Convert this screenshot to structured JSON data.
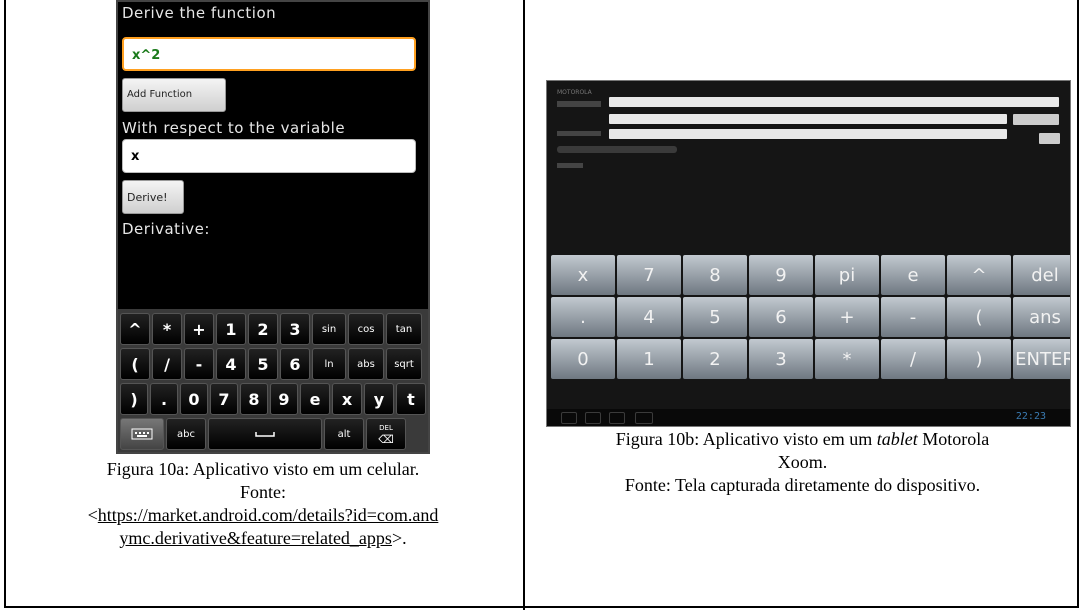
{
  "phone_screen": {
    "derive_label": "Derive the function",
    "function_value": "x^2",
    "add_function_label": "Add Function",
    "variable_label": "With respect to the variable",
    "variable_value": "x",
    "derive_button_label": "Derive!",
    "derivative_label": "Derivative:",
    "keyboard_rows": [
      [
        "^",
        "*",
        "+",
        "1",
        "2",
        "3",
        "sin",
        "cos",
        "tan"
      ],
      [
        "(",
        "/",
        "-",
        "4",
        "5",
        "6",
        "ln",
        "abs",
        "sqrt"
      ],
      [
        ")",
        ".",
        "0",
        "7",
        "8",
        "9",
        "e",
        "x",
        "y",
        "t"
      ]
    ],
    "bottom_row": {
      "abc": "abc",
      "alt": "alt",
      "del_top": "DEL",
      "del_bottom": "⌫"
    }
  },
  "tablet_screen": {
    "brand": "MOTOROLA",
    "keys": [
      "x",
      "7",
      "8",
      "9",
      "pi",
      "e",
      "^",
      "del",
      ".",
      "4",
      "5",
      "6",
      "+",
      "-",
      "(",
      "ans",
      "0",
      "1",
      "2",
      "3",
      "*",
      "/",
      ")",
      "ENTER"
    ],
    "clock": "22:23"
  },
  "caption_left": {
    "line1": "Figura 10a: Aplicativo visto em um celular.",
    "line2": "Fonte:",
    "link_open": "<",
    "link_part1": "https://market.android.com/details?id=com.and",
    "link_part2": "ymc.derivative&feature=related_apps",
    "link_close": ">."
  },
  "caption_right": {
    "line1_prefix": "Figura 10b: Aplicativo visto em um ",
    "line1_italic": "tablet",
    "line1_suffix": " Motorola",
    "line2": "Xoom.",
    "line3": "Fonte: Tela capturada diretamente do dispositivo."
  }
}
